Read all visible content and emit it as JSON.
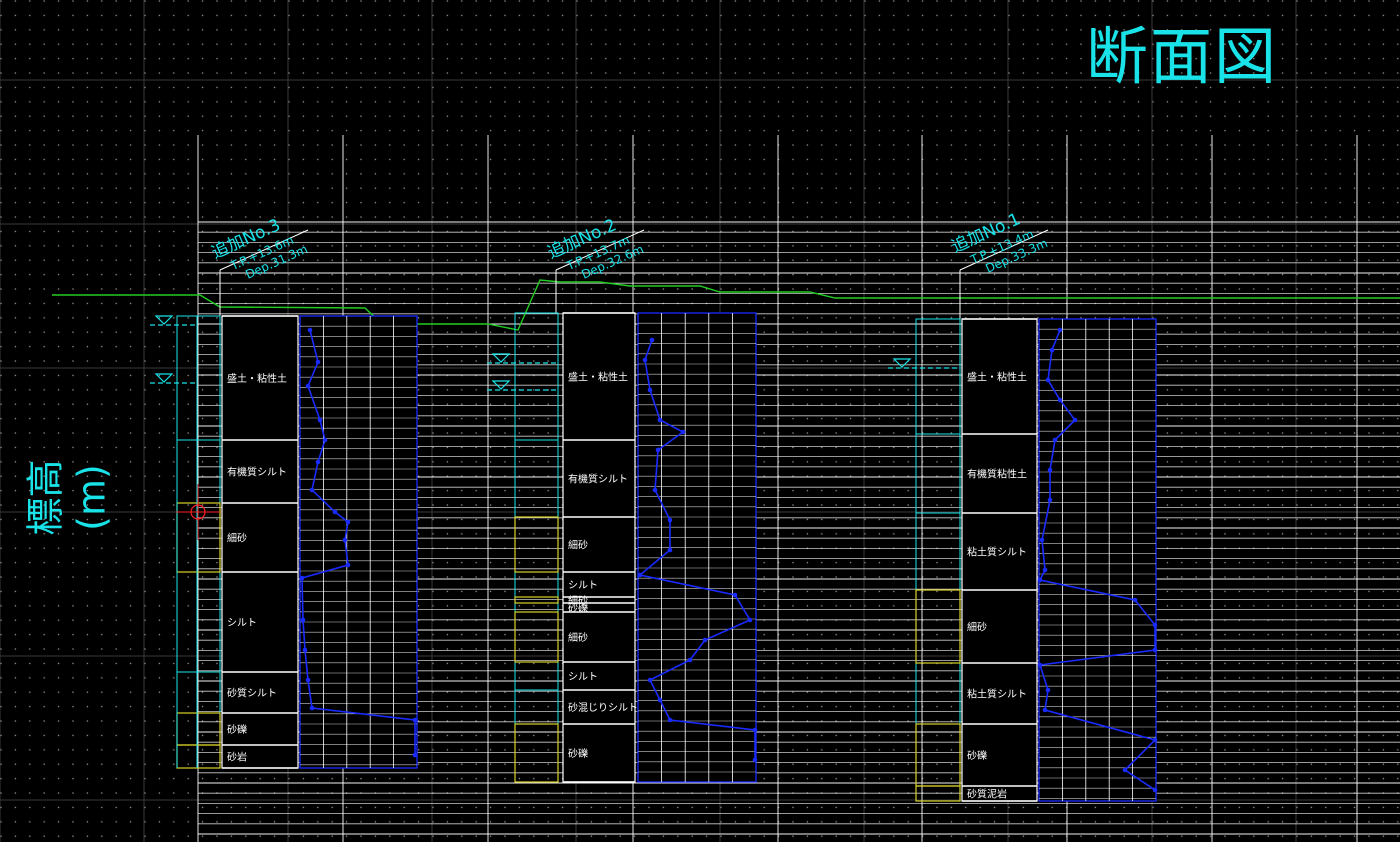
{
  "title": "断面図",
  "y_axis_label": "標高 (m)",
  "colors": {
    "background": "#000000",
    "grid": "#ffffff",
    "accent": "#19e3e8",
    "ground_line": "#22cc22",
    "n_value": "#1a2bff",
    "sand_layer": "#d9d12a",
    "water_level": "#19e3e8",
    "marker": "#ff2020"
  },
  "boreholes": [
    {
      "name": "追加No.3",
      "tp": "T.P.+13.6m",
      "dep": "Dep.31.3m",
      "layers": [
        {
          "label": "盛土・粘性土"
        },
        {
          "label": "有機質シルト"
        },
        {
          "label": "細砂"
        },
        {
          "label": "シルト"
        },
        {
          "label": "砂質シルト"
        },
        {
          "label": "砂礫"
        },
        {
          "label": "砂岩"
        }
      ]
    },
    {
      "name": "追加No.2",
      "tp": "T.P.+13.7m",
      "dep": "Dep.32.6m",
      "layers": [
        {
          "label": "盛土・粘性土"
        },
        {
          "label": "有機質シルト"
        },
        {
          "label": "細砂"
        },
        {
          "label": "シルト"
        },
        {
          "label": "細砂"
        },
        {
          "label": "砂礫"
        },
        {
          "label": "細砂"
        },
        {
          "label": "シルト"
        },
        {
          "label": "砂混じりシルト"
        },
        {
          "label": "砂礫"
        }
      ]
    },
    {
      "name": "追加No.1",
      "tp": "T.P.+13.4m",
      "dep": "Dep.33.3m",
      "layers": [
        {
          "label": "盛土・粘性土"
        },
        {
          "label": "有機質粘性土"
        },
        {
          "label": "粘土質シルト"
        },
        {
          "label": "細砂"
        },
        {
          "label": "粘土質シルト"
        },
        {
          "label": "砂礫"
        },
        {
          "label": "砂質泥岩"
        }
      ]
    }
  ]
}
